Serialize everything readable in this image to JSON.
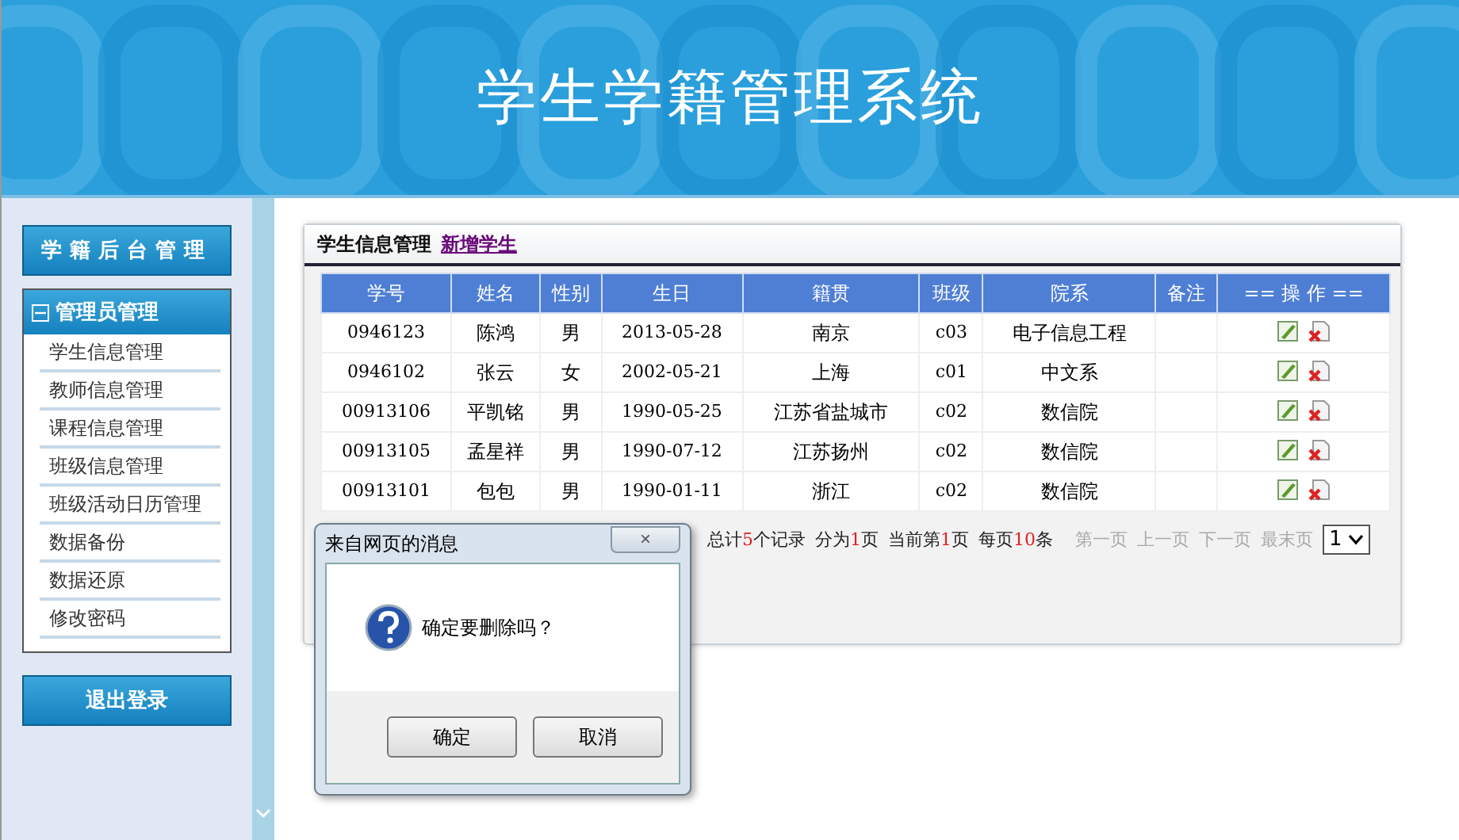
{
  "header": {
    "title": "学生学籍管理系统"
  },
  "sidebar": {
    "title": "学籍后台管理",
    "group": {
      "title": "管理员管理",
      "expanded": true,
      "items": [
        {
          "label": "学生信息管理"
        },
        {
          "label": "教师信息管理"
        },
        {
          "label": "课程信息管理"
        },
        {
          "label": "班级信息管理"
        },
        {
          "label": "班级活动日历管理"
        },
        {
          "label": "数据备份"
        },
        {
          "label": "数据还原"
        },
        {
          "label": "修改密码"
        }
      ]
    },
    "logout": "退出登录"
  },
  "panel": {
    "title": "学生信息管理",
    "link": "新增学生"
  },
  "table": {
    "columns": [
      "学号",
      "姓名",
      "性别",
      "生日",
      "籍贯",
      "班级",
      "院系",
      "备注",
      "== 操 作 =="
    ],
    "rows": [
      [
        "0946123",
        "陈鸿",
        "男",
        "2013-05-28",
        "南京",
        "c03",
        "电子信息工程",
        ""
      ],
      [
        "0946102",
        "张云",
        "女",
        "2002-05-21",
        "上海",
        "c01",
        "中文系",
        ""
      ],
      [
        "00913106",
        "平凯铭",
        "男",
        "1990-05-25",
        "江苏省盐城市",
        "c02",
        "数信院",
        ""
      ],
      [
        "00913105",
        "孟星祥",
        "男",
        "1990-07-12",
        "江苏扬州",
        "c02",
        "数信院",
        ""
      ],
      [
        "00913101",
        "包包",
        "男",
        "1990-01-11",
        "浙江",
        "c02",
        "数信院",
        ""
      ]
    ]
  },
  "pagination": {
    "stats": [
      {
        "before": "总计",
        "value": "5",
        "after": "个记录"
      },
      {
        "before": "分为",
        "value": "1",
        "after": "页"
      },
      {
        "before": "当前第",
        "value": "1",
        "after": "页"
      },
      {
        "before": "每页",
        "value": "10",
        "after": "条"
      }
    ],
    "links": [
      {
        "label": "第一页",
        "disabled": true
      },
      {
        "label": "上一页",
        "disabled": true
      },
      {
        "label": "下一页",
        "disabled": true
      },
      {
        "label": "最末页",
        "disabled": true
      }
    ],
    "page_select": "1"
  },
  "dialog": {
    "title": "来自网页的消息",
    "close": "×",
    "message": "确定要删除吗？",
    "buttons": [
      "确定",
      "取消"
    ]
  }
}
